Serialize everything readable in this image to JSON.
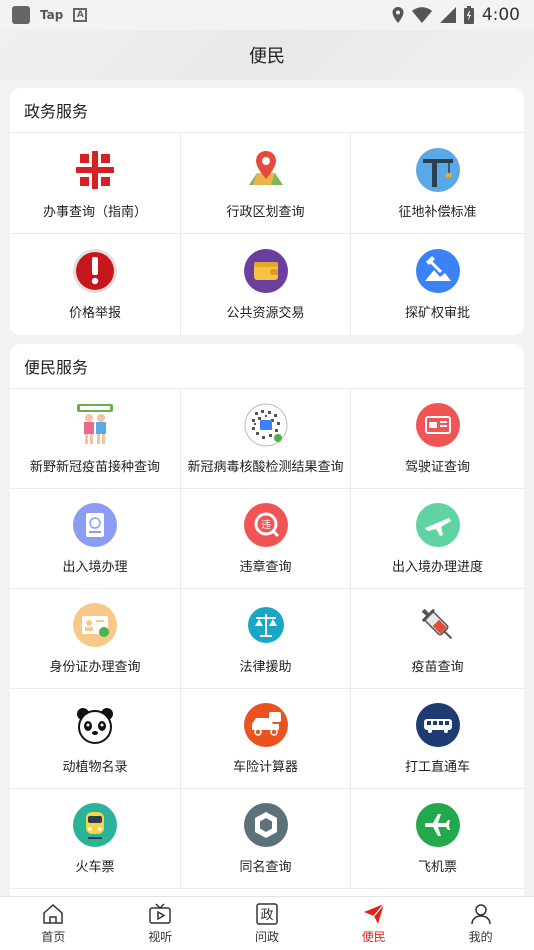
{
  "status_bar": {
    "app_label": "Tap",
    "a_label": "A",
    "time": "4:00"
  },
  "header": {
    "title": "便民"
  },
  "gov_section": {
    "title": "政务服务",
    "items": [
      {
        "label": "办事查询（指南）",
        "icon": "service-guide-icon"
      },
      {
        "label": "行政区划查询",
        "icon": "map-pin-icon"
      },
      {
        "label": "征地补偿标准",
        "icon": "crane-icon"
      },
      {
        "label": "价格举报",
        "icon": "alert-icon"
      },
      {
        "label": "公共资源交易",
        "icon": "wallet-icon"
      },
      {
        "label": "探矿权审批",
        "icon": "mining-icon"
      }
    ]
  },
  "people_section": {
    "title": "便民服务",
    "items": [
      {
        "label": "新野新冠疫苗接种查询",
        "icon": "vaccination-people-icon"
      },
      {
        "label": "新冠病毒核酸检测结果查询",
        "icon": "qr-code-icon"
      },
      {
        "label": "驾驶证查询",
        "icon": "driver-license-icon"
      },
      {
        "label": "出入境办理",
        "icon": "passport-icon"
      },
      {
        "label": "违章查询",
        "icon": "violation-icon"
      },
      {
        "label": "出入境办理进度",
        "icon": "plane-progress-icon"
      },
      {
        "label": "身份证办理查询",
        "icon": "id-card-icon"
      },
      {
        "label": "法律援助",
        "icon": "scales-icon"
      },
      {
        "label": "疫苗查询",
        "icon": "syringe-icon"
      },
      {
        "label": "动植物名录",
        "icon": "panda-icon"
      },
      {
        "label": "车险计算器",
        "icon": "car-insurance-icon"
      },
      {
        "label": "打工直通车",
        "icon": "bus-icon"
      },
      {
        "label": "火车票",
        "icon": "train-icon"
      },
      {
        "label": "同名查询",
        "icon": "same-name-icon"
      },
      {
        "label": "飞机票",
        "icon": "airplane-icon"
      }
    ]
  },
  "tabbar": {
    "items": [
      {
        "label": "首页",
        "icon": "home-icon"
      },
      {
        "label": "视听",
        "icon": "tv-icon"
      },
      {
        "label": "问政",
        "icon": "zheng-icon"
      },
      {
        "label": "便民",
        "icon": "paper-plane-icon",
        "active": true
      },
      {
        "label": "我的",
        "icon": "user-icon"
      }
    ]
  },
  "colors": {
    "accent": "#e2231a",
    "background": "#f2f2f2"
  }
}
